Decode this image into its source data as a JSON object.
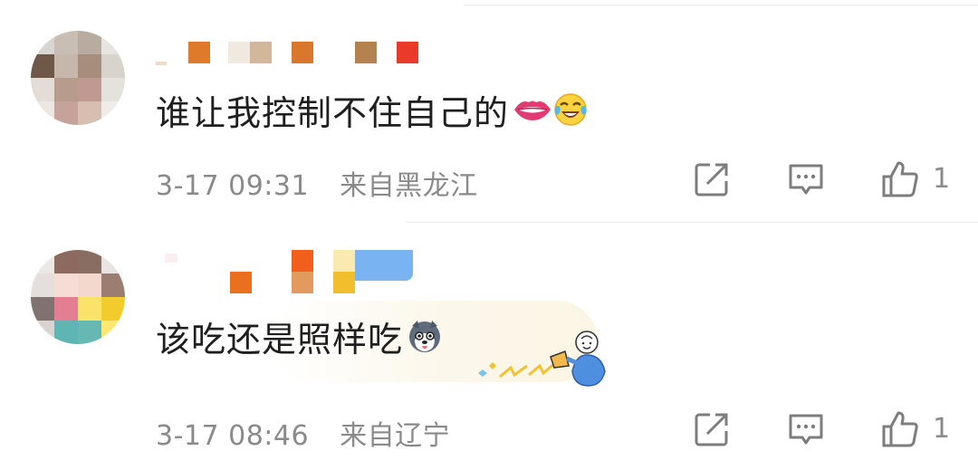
{
  "comments": [
    {
      "text": "谁让我控制不住自己的",
      "emojis": [
        "lips-icon",
        "laugh-crying-icon"
      ],
      "time": "3-17 09:31",
      "location": "来自黑龙江",
      "likes": "1"
    },
    {
      "text": "该吃还是照样吃",
      "emojis": [
        "husky-dog-icon"
      ],
      "time": "3-17 08:46",
      "location": "来自辽宁",
      "likes": "1",
      "decoration": "cheering-figure-sticker"
    }
  ],
  "icons": {
    "share": "share-icon",
    "reply": "comment-icon",
    "like": "thumbs-up-icon"
  },
  "colors": {
    "text": "#1f1f1f",
    "meta": "#8a8a8a",
    "divider": "#ececec"
  }
}
